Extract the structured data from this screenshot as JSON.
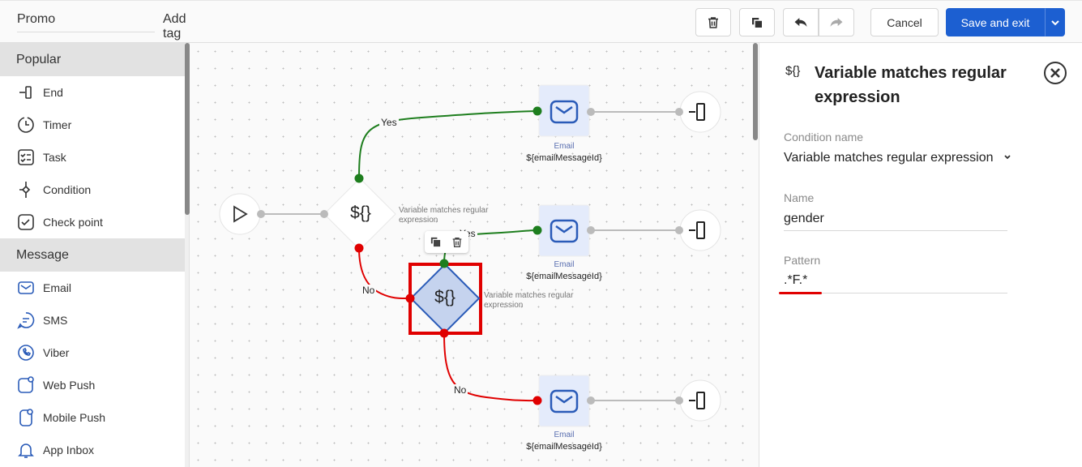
{
  "header": {
    "campaign_name": "Promo",
    "add_tag": "Add tag",
    "cancel": "Cancel",
    "save_and_exit": "Save and exit"
  },
  "sidebar": {
    "sections": [
      {
        "title": "Popular",
        "items": [
          {
            "label": "End",
            "icon": "end-icon"
          },
          {
            "label": "Timer",
            "icon": "timer-icon"
          },
          {
            "label": "Task",
            "icon": "task-icon"
          },
          {
            "label": "Condition",
            "icon": "condition-icon"
          },
          {
            "label": "Check point",
            "icon": "checkpoint-icon"
          }
        ]
      },
      {
        "title": "Message",
        "items": [
          {
            "label": "Email",
            "icon": "email-icon"
          },
          {
            "label": "SMS",
            "icon": "sms-icon"
          },
          {
            "label": "Viber",
            "icon": "viber-icon"
          },
          {
            "label": "Web Push",
            "icon": "web-push-icon"
          },
          {
            "label": "Mobile Push",
            "icon": "mobile-push-icon"
          },
          {
            "label": "App Inbox",
            "icon": "bell-icon"
          }
        ]
      }
    ]
  },
  "canvas": {
    "condition_symbol": "${}",
    "condition_label": "Variable matches regular expression",
    "edge_yes": "Yes",
    "edge_no": "No",
    "email_label": "Email",
    "email_id": "${emailMessageId}"
  },
  "panel": {
    "icon_symbol": "${}",
    "title": "Variable matches regular expression",
    "condition_name_label": "Condition name",
    "condition_name_value": "Variable matches regular expression",
    "name_label": "Name",
    "name_value": "gender",
    "pattern_label": "Pattern",
    "pattern_value": ".*F.*"
  },
  "colors": {
    "primary": "#1c5fd1",
    "yes": "#1e7e1e",
    "no": "#e00000",
    "selected": "#e00000"
  }
}
